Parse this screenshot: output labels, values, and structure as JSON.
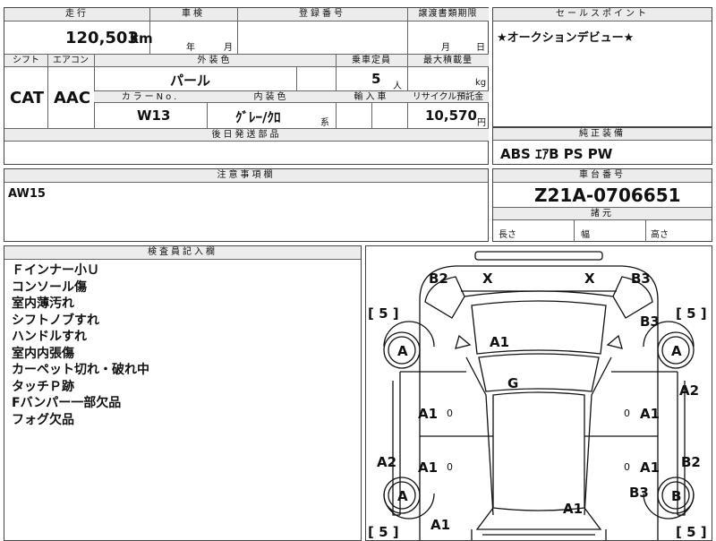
{
  "vehicle": {
    "mileage_label": "走行",
    "mileage_value": "120,503",
    "mileage_unit": "km",
    "inspection_label": "車検",
    "inspection_year": "年",
    "inspection_month": "月",
    "registration_label": "登録番号",
    "transfer_label": "譲渡書類期限",
    "transfer_month": "月",
    "transfer_day": "日",
    "shift_label": "シフト",
    "shift_value": "CAT",
    "aircon_label": "エアコン",
    "aircon_value": "AAC",
    "exterior_label": "外装色",
    "exterior_value": "パール",
    "capacity_label": "乗車定員",
    "capacity_value": "5",
    "capacity_unit": "人",
    "load_label": "最大積載量",
    "load_unit": "kg",
    "color_no_label": "カラーNo.",
    "color_no_value": "W13",
    "interior_label": "内装色",
    "interior_value": "ｸﾞﾚｰ/ｸﾛ",
    "interior_suffix": "系",
    "import_label": "輸入車",
    "recycle_label": "リサイクル預託金",
    "recycle_value": "10,570",
    "recycle_unit": "円",
    "later_parts_label": "後日発送部品"
  },
  "sales_point": {
    "label": "セールスポイント",
    "text": "★オークションデビュー★"
  },
  "equipment": {
    "label": "純正装備",
    "text": "ABS ｴｱB PS PW"
  },
  "caution": {
    "label": "注意事項欄",
    "text": "AW15"
  },
  "chassis": {
    "label": "車台番号",
    "value": "Z21A-0706651",
    "dims_label": "諸元",
    "length_label": "長さ",
    "width_label": "幅",
    "height_label": "高さ"
  },
  "inspector": {
    "label": "検査員記入欄",
    "notes": [
      "Ｆインナー小Ｕ",
      "コンソール傷",
      "室内薄汚れ",
      "シフトノブすれ",
      "ハンドルすれ",
      "室内内張傷",
      "カーペット切れ・破れ中",
      "タッチＰ跡",
      "Fバンパー一部欠品",
      "フォグ欠品"
    ]
  },
  "diagram": {
    "marks": {
      "b2_top_left": "B2",
      "x_left": "X",
      "x_right": "X",
      "b3_top_right": "B3",
      "tire_front_left_bracket": "[ 5 ]",
      "tire_front_right_bracket": "[ 5 ]",
      "b3_right_fender": "B3",
      "a_wheel_front_left": "A",
      "a_wheel_front_right": "A",
      "a1_hood": "A1",
      "g_windshield": "G",
      "a2_right": "A2",
      "a1_door_fl": "A1",
      "a1_door_fr": "A1",
      "a2_left": "A2",
      "a1_door_rl": "A1",
      "a1_door_rr": "A1",
      "b2_right": "B2",
      "a_wheel_rear_left": "A",
      "b3_rear_right": "B3",
      "b_wheel_rear_right": "B",
      "a1_trunk": "A1",
      "a1_rear_left": "A1",
      "tire_rear_left_bracket": "[ 5 ]",
      "tire_rear_right_bracket": "[ 5 ]",
      "door_fl_icon": "0",
      "door_fr_icon": "0",
      "door_rl_icon": "0",
      "door_rr_icon": "0"
    }
  }
}
